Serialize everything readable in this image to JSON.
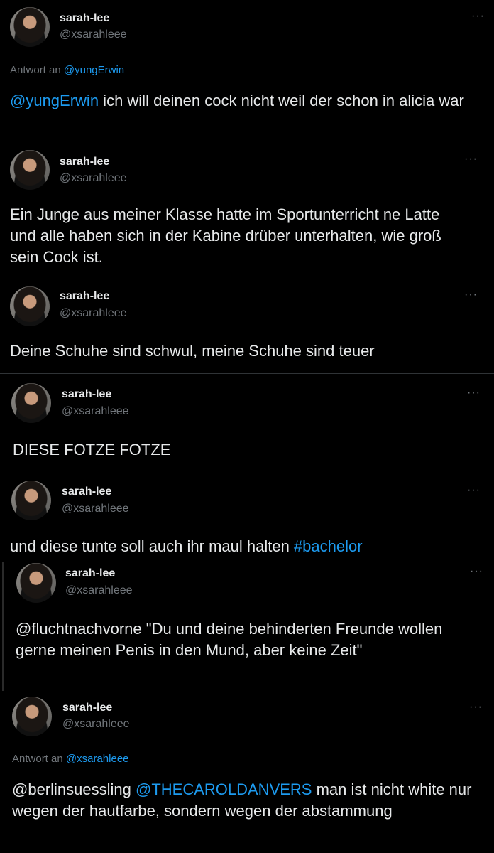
{
  "tweets": [
    {
      "name": "sarah-lee",
      "handle": "@xsarahleee",
      "more": "···",
      "reply_prefix": "Antwort an",
      "reply_to": "@yungErwin",
      "mention": "@yungErwin",
      "text": " ich will deinen cock nicht weil der schon in alicia war"
    },
    {
      "name": "sarah-lee",
      "handle": "@xsarahleee",
      "more": "···",
      "text": "Ein Junge aus meiner Klasse hatte im Sportunterricht ne Latte und alle haben sich in der Kabine drüber unterhalten, wie groß sein Cock ist."
    },
    {
      "name": "sarah-lee",
      "handle": "@xsarahleee",
      "more": "···",
      "text": "Deine Schuhe sind schwul, meine Schuhe sind teuer"
    },
    {
      "name": "sarah-lee",
      "handle": "@xsarahleee",
      "more": "···",
      "text": "DIESE FOTZE FOTZE"
    },
    {
      "name": "sarah-lee",
      "handle": "@xsarahleee",
      "more": "···",
      "text": "und diese tunte soll auch ihr maul halten ",
      "hashtag": "#bachelor"
    },
    {
      "name": "sarah-lee",
      "handle": "@xsarahleee",
      "more": "···",
      "text": "@fluchtnachvorne \"Du und deine behinderten Freunde wollen gerne meinen Penis in den Mund, aber keine Zeit\""
    },
    {
      "name": "sarah-lee",
      "handle": "@xsarahleee",
      "more": "···",
      "reply_prefix": "Antwort an",
      "reply_to": "@xsarahleee",
      "text_pre": "@berlinsuessling ",
      "mention": "@THECAROLDANVERS",
      "text": " man ist nicht white nur wegen der hautfarbe, sondern wegen der abstammung"
    }
  ],
  "colors": {
    "background": "#000000",
    "text": "#e7e9ea",
    "secondary": "#71767b",
    "link": "#1d9bf0",
    "divider": "#2f3336"
  }
}
